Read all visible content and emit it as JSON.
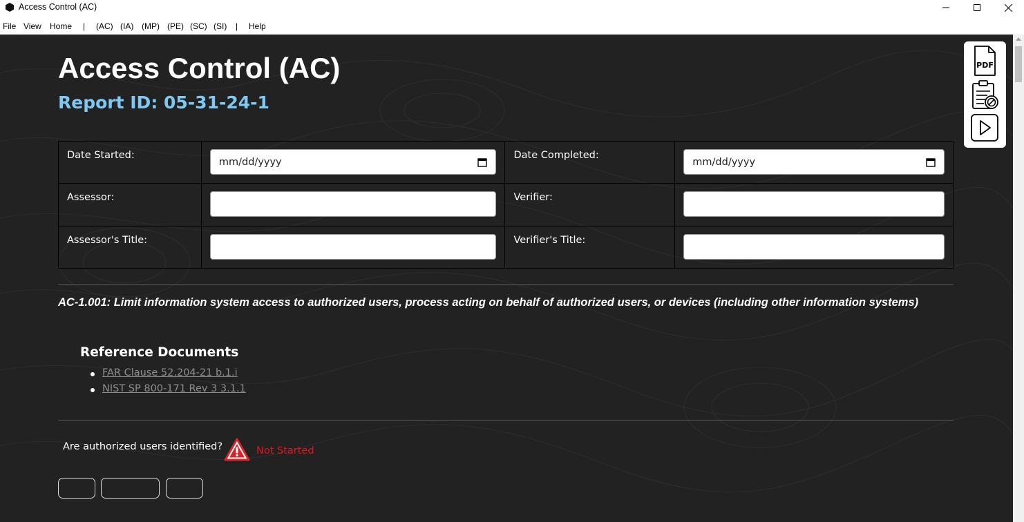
{
  "window": {
    "title": "Access Control (AC)"
  },
  "menu": {
    "items": [
      "File",
      "View",
      "Home",
      "(AC)",
      "(IA)",
      "(MP)",
      "(PE)",
      "(SC)",
      "(SI)",
      "Help"
    ],
    "separator": "|"
  },
  "toolbar": {
    "pdf_label": "PDF"
  },
  "page": {
    "title": "Access Control (AC)",
    "report_id": "Report ID: 05-31-24-1"
  },
  "form": {
    "date_started_label": "Date Started:",
    "date_started_placeholder": "mm/dd/yyyy",
    "date_completed_label": "Date Completed:",
    "date_completed_placeholder": "mm/dd/yyyy",
    "assessor_label": "Assessor:",
    "assessor_value": "",
    "verifier_label": "Verifier:",
    "verifier_value": "",
    "assessor_title_label": "Assessor's Title:",
    "assessor_title_value": "",
    "verifier_title_label": "Verifier's Title:",
    "verifier_title_value": ""
  },
  "requirement": {
    "text": "AC-1.001: Limit information system access to authorized users, process acting on behalf of authorized users, or devices (including other information systems)"
  },
  "references": {
    "heading": "Reference Documents",
    "links": [
      "FAR Clause 52.204-21 b.1.i",
      "NIST SP 800-171 Rev 3 3.1.1"
    ]
  },
  "assessment": {
    "question": "Are authorized users identified?",
    "status": "Not Started",
    "status_color": "#e8141c"
  },
  "colors": {
    "background": "#222222",
    "accent": "#7ec8f2",
    "link": "#8e8e8e"
  }
}
